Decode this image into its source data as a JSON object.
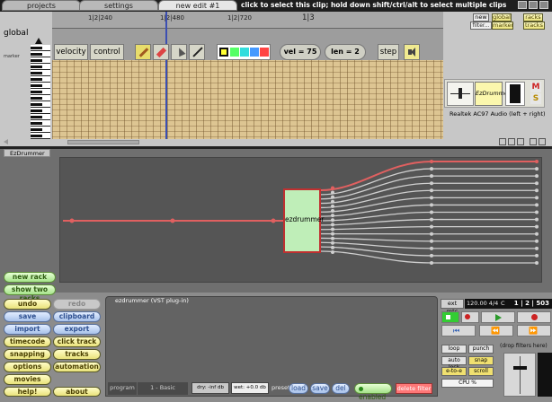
{
  "tabs": {
    "projects": "projects",
    "settings": "settings",
    "edit": "new edit #1"
  },
  "hint": "click to select this clip; hold down shift/ctrl/alt to select multiple clips",
  "corner_btns": {
    "new": "new",
    "filter": "filter...",
    "global": "global",
    "marker": "marker",
    "racks": "racks",
    "tracks": "tracks"
  },
  "timeline": {
    "global_label": "global",
    "marker_label": "marker",
    "ticks": [
      "1|2|240",
      "1|2|480",
      "1|2|720",
      "1|3"
    ]
  },
  "editor_toolbar": {
    "velocity": "velocity",
    "control": "control",
    "vel": "vel = 75",
    "len": "len = 2",
    "step": "step"
  },
  "colors": {
    "yellow": "#ffff33",
    "green": "#55ff66",
    "cyan": "#33dddd",
    "blue": "#4499ff",
    "red": "#ff4444"
  },
  "track": {
    "plugin": "EzDrummer",
    "device": "Realtek AC97 Audio (left + right)",
    "m": "M",
    "s": "S"
  },
  "rack": {
    "tab": "EzDrummer",
    "node": "ezdrummer",
    "output_count": 15
  },
  "left": {
    "new_rack": "new rack",
    "show_two_racks": "show two racks",
    "undo": "undo",
    "redo": "redo",
    "save": "save",
    "clipboard": "clipboard",
    "import": "import",
    "export": "export",
    "timecode": "timecode",
    "click_track": "click track",
    "snapping": "snapping",
    "tracks": "tracks",
    "options": "options",
    "automation": "automation",
    "movies": "movies",
    "help": "help!",
    "about": "about"
  },
  "plugin": {
    "title": "ezdrummer (VST plug-in)",
    "program_label": "program",
    "program": "1 - Basic",
    "dry": "dry: -inf db",
    "wet": "wet: +0.0 db",
    "preset": "preset:",
    "load": "load",
    "save": "save",
    "del": "del",
    "enabled": "enabled",
    "delete_filter": "delete filter"
  },
  "transport": {
    "ext_mtc": "ext mtc",
    "tempo": "120.00 4/4",
    "key": "C",
    "pos": "1 | 2 | 503",
    "loop": "loop",
    "punch": "punch",
    "auto_lock": "auto lock",
    "snap": "snap",
    "eto": "e-to-e",
    "scroll": "scroll",
    "cpu": "CPU %",
    "drop": "(drop filters here)"
  }
}
